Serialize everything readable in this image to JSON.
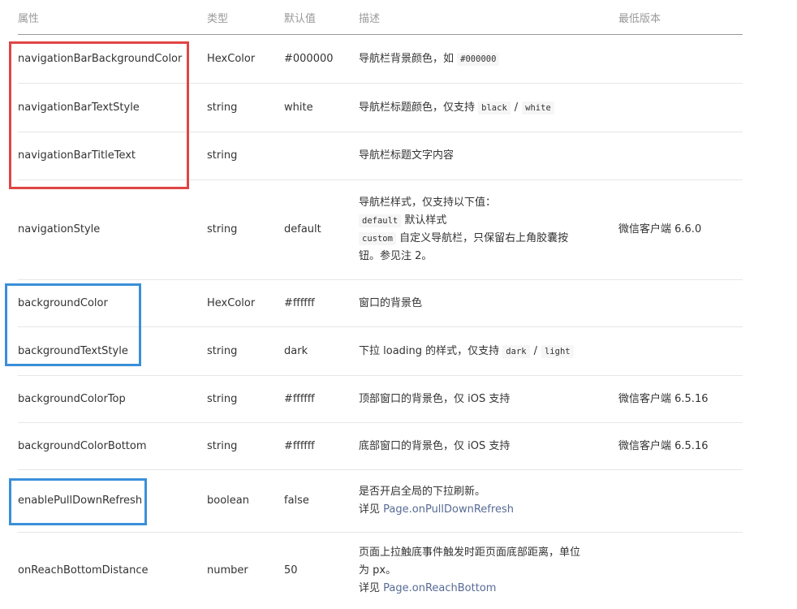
{
  "headers": {
    "name": "属性",
    "type": "类型",
    "default": "默认值",
    "desc": "描述",
    "version": "最低版本"
  },
  "rows": [
    {
      "name": "navigationBarBackgroundColor",
      "type": "HexColor",
      "default": "#000000",
      "desc_text": "导航栏背景颜色，如",
      "desc_code": "#000000",
      "version": ""
    },
    {
      "name": "navigationBarTextStyle",
      "type": "string",
      "default": "white",
      "desc_text": "导航栏标题颜色，仅支持",
      "desc_code1": "black",
      "desc_sep": "/",
      "desc_code2": "white",
      "version": ""
    },
    {
      "name": "navigationBarTitleText",
      "type": "string",
      "default": "",
      "desc_text": "导航栏标题文字内容",
      "version": ""
    },
    {
      "name": "navigationStyle",
      "type": "string",
      "default": "default",
      "desc_line1": "导航栏样式，仅支持以下值：",
      "desc_code1": "default",
      "desc_text1": "默认样式",
      "desc_code2": "custom",
      "desc_text2": "自定义导航栏，只保留右上角胶囊按",
      "desc_line4": "钮。参见注 2。",
      "version": "微信客户端 6.6.0"
    },
    {
      "name": "backgroundColor",
      "type": "HexColor",
      "default": "#ffffff",
      "desc_text": "窗口的背景色",
      "version": ""
    },
    {
      "name": "backgroundTextStyle",
      "type": "string",
      "default": "dark",
      "desc_text": "下拉 loading 的样式，仅支持",
      "desc_code1": "dark",
      "desc_sep": "/",
      "desc_code2": "light",
      "version": ""
    },
    {
      "name": "backgroundColorTop",
      "type": "string",
      "default": "#ffffff",
      "desc_text": "顶部窗口的背景色，仅 iOS 支持",
      "version": "微信客户端 6.5.16"
    },
    {
      "name": "backgroundColorBottom",
      "type": "string",
      "default": "#ffffff",
      "desc_text": "底部窗口的背景色，仅 iOS 支持",
      "version": "微信客户端 6.5.16"
    },
    {
      "name": "enablePullDownRefresh",
      "type": "boolean",
      "default": "false",
      "desc_line1": "是否开启全局的下拉刷新。",
      "desc_prefix": "详见",
      "desc_link": "Page.onPullDownRefresh",
      "version": ""
    },
    {
      "name": "onReachBottomDistance",
      "type": "number",
      "default": "50",
      "desc_line1": "页面上拉触底事件触发时距页面底部距离，单位",
      "desc_line2": "为 px。",
      "desc_prefix": "详见",
      "desc_link": "Page.onReachBottom",
      "version": ""
    }
  ],
  "colors": {
    "red_box": "#e04545",
    "blue_box": "#3a8fd9",
    "link": "#576b95",
    "header_text": "#999999",
    "body_text": "#333333"
  }
}
